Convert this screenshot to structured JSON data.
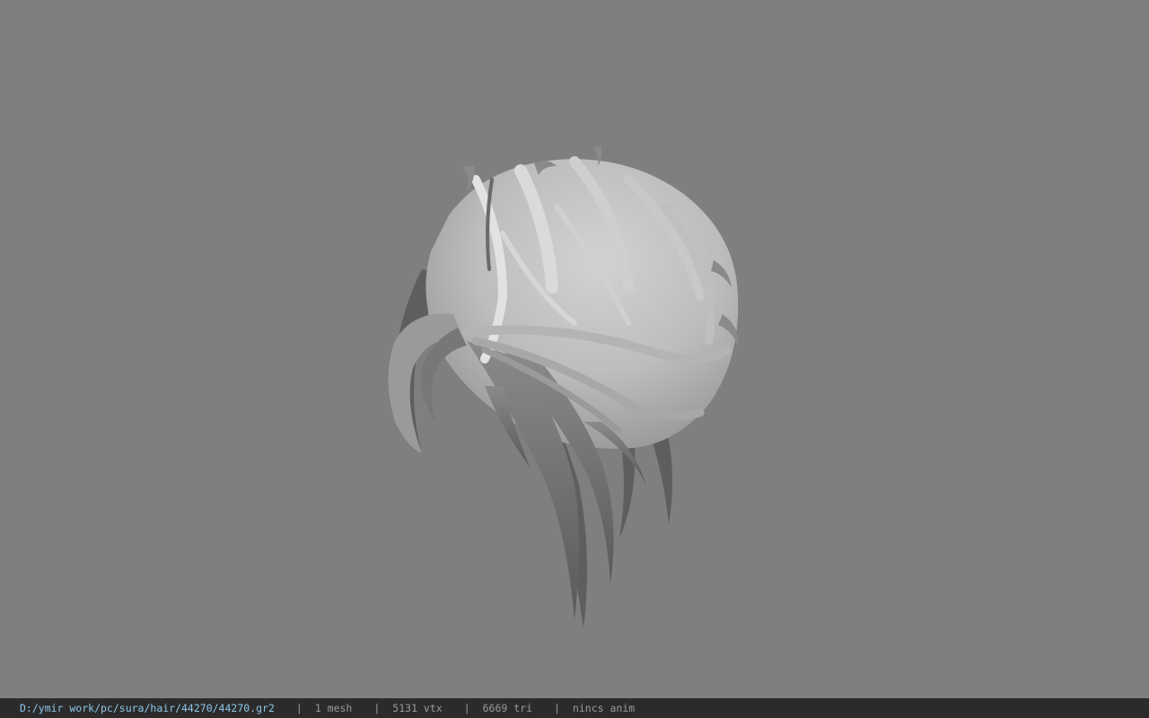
{
  "viewport": {
    "model_icon": "hair-mesh-icon",
    "background_color": "#7f7f7f"
  },
  "statusbar": {
    "file_path": "D:/ymir work/pc/sura/hair/44270/44270.gr2",
    "separator": "|",
    "mesh_count": "1 mesh",
    "vertex_count": "5131 vtx",
    "triangle_count": "6669 tri",
    "anim_status": "nincs anim"
  }
}
